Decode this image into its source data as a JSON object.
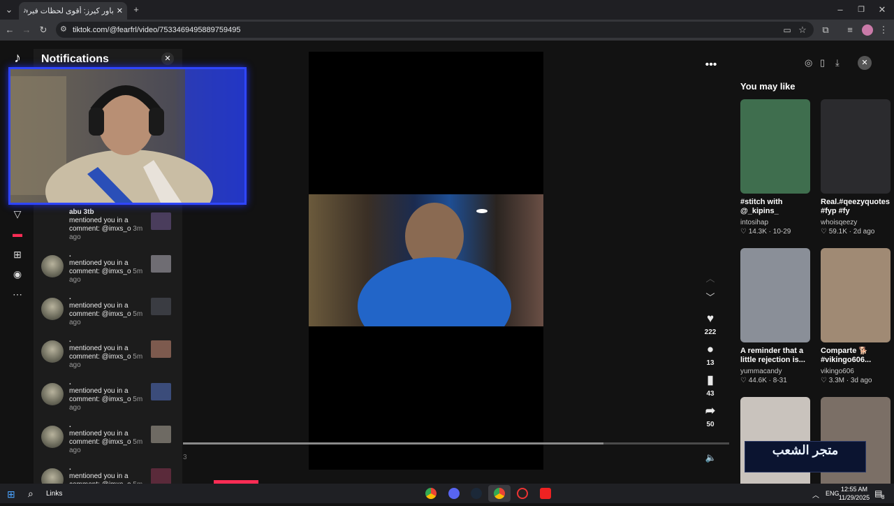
{
  "browser": {
    "tab_title": "باور كيرز: أقوى لحظات فيرفول مع",
    "url": "tiktok.com/@fearfrl/video/7533469495889759495"
  },
  "notifications": {
    "title": "Notifications",
    "items": [
      {
        "name": "abu 3tb",
        "text": "mentioned you in a comment: @imxs_o",
        "time": "3m",
        "suffix": "ago"
      },
      {
        "name": ".",
        "text": "mentioned you in a comment: @imxs_o",
        "time": "5m",
        "suffix": "ago"
      },
      {
        "name": ".",
        "text": "mentioned you in a comment: @imxs_o",
        "time": "5m",
        "suffix": "ago"
      },
      {
        "name": ".",
        "text": "mentioned you in a comment: @imxs_o",
        "time": "5m",
        "suffix": "ago"
      },
      {
        "name": ".",
        "text": "mentioned you in a comment: @imxs_o",
        "time": "5m",
        "suffix": "ago"
      },
      {
        "name": ".",
        "text": "mentioned you in a comment: @imxs_o",
        "time": "5m",
        "suffix": "ago"
      },
      {
        "name": ".",
        "text": "mentioned you in a comment: @imxs_o",
        "time": "5m",
        "suffix": ""
      }
    ]
  },
  "video": {
    "time_label": "3",
    "progress": 0.77,
    "likes": "222",
    "comments": "13",
    "saves": "43",
    "shares": "50"
  },
  "you_may_like": {
    "title": "You may like",
    "cards": [
      {
        "title": "#stitch with @_kipins_ Akibat...",
        "user": "intosihap",
        "likes": "14.3K",
        "date": "10-29",
        "color": "#3f6e4e"
      },
      {
        "title": "Real.#qeezyquotes #fyp #fy",
        "user": "whoisqeezy",
        "likes": "59.1K",
        "date": "2d ago",
        "color": "#2b2b2e"
      },
      {
        "title": "A reminder that a little rejection is...",
        "user": "yummacandy",
        "likes": "44.6K",
        "date": "8-31",
        "color": "#8a8f98"
      },
      {
        "title": "Comparte 🐕 #vikingo606...",
        "user": "vikingo606",
        "likes": "3.3M",
        "date": "3d ago",
        "color": "#a08a74"
      },
      {
        "title": "",
        "user": "",
        "likes": "",
        "date": "",
        "color": "#c9c3bd"
      },
      {
        "title": "",
        "user": "",
        "likes": "",
        "date": "",
        "color": "#7b6f66"
      }
    ]
  },
  "overlay_logo": "متجر الشعب",
  "taskbar": {
    "search_label": "Links",
    "language": "ENG",
    "time": "12:55 AM",
    "date": "11/29/2025",
    "notification_count": "8"
  }
}
